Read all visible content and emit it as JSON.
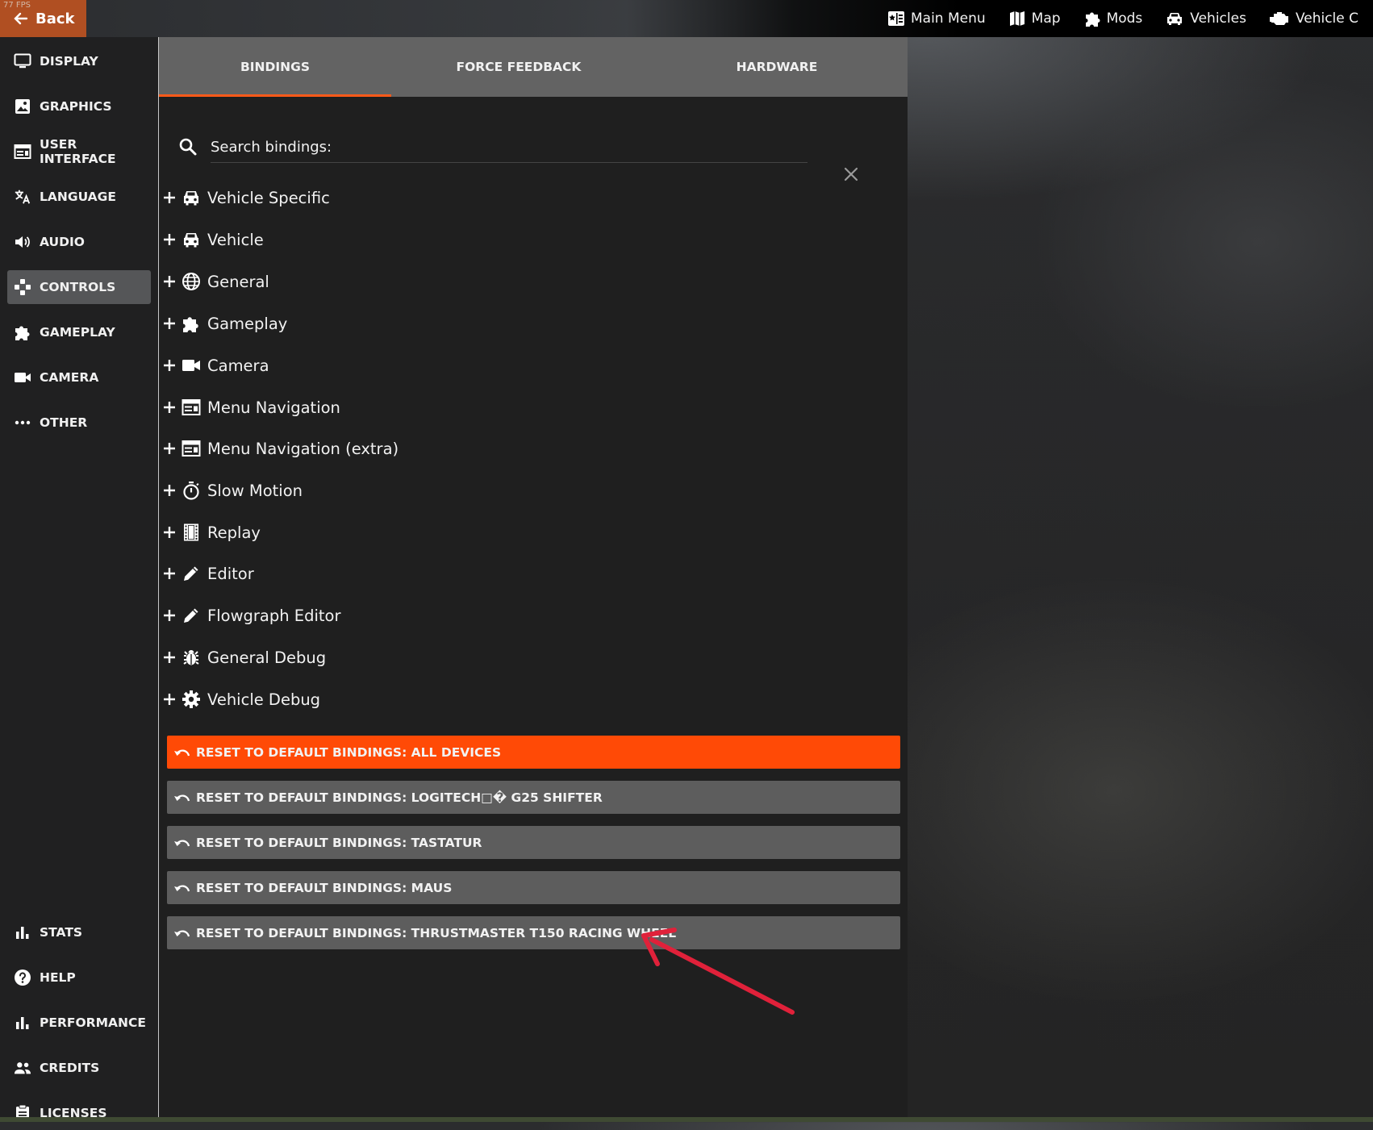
{
  "fps_counter": "77 FPS",
  "topbar": {
    "back_label": "Back",
    "nav": [
      {
        "label": "Main Menu",
        "icon": "main-menu-icon"
      },
      {
        "label": "Map",
        "icon": "map-icon"
      },
      {
        "label": "Mods",
        "icon": "puzzle-icon"
      },
      {
        "label": "Vehicles",
        "icon": "car-icon"
      },
      {
        "label": "Vehicle C",
        "icon": "engine-icon"
      }
    ]
  },
  "sidebar": {
    "items": [
      {
        "label": "DISPLAY",
        "icon": "monitor-icon"
      },
      {
        "label": "GRAPHICS",
        "icon": "image-icon"
      },
      {
        "label": "USER INTERFACE",
        "icon": "window-icon"
      },
      {
        "label": "LANGUAGE",
        "icon": "translate-icon"
      },
      {
        "label": "AUDIO",
        "icon": "speaker-icon"
      },
      {
        "label": "CONTROLS",
        "icon": "gamepad-icon",
        "active": true
      },
      {
        "label": "GAMEPLAY",
        "icon": "puzzle-icon"
      },
      {
        "label": "CAMERA",
        "icon": "camera-icon"
      },
      {
        "label": "OTHER",
        "icon": "more-icon"
      }
    ],
    "bottom_items": [
      {
        "label": "STATS",
        "icon": "bar-chart-icon"
      },
      {
        "label": "HELP",
        "icon": "help-icon"
      },
      {
        "label": "PERFORMANCE",
        "icon": "bar-chart-icon"
      },
      {
        "label": "CREDITS",
        "icon": "people-icon"
      },
      {
        "label": "LICENSES",
        "icon": "clipboard-icon"
      }
    ]
  },
  "tabs": [
    {
      "label": "BINDINGS",
      "active": true
    },
    {
      "label": "FORCE FEEDBACK"
    },
    {
      "label": "HARDWARE"
    }
  ],
  "search": {
    "placeholder": "Search bindings:",
    "value": ""
  },
  "categories": [
    {
      "label": "Vehicle Specific",
      "icon": "car-icon"
    },
    {
      "label": "Vehicle",
      "icon": "car-icon"
    },
    {
      "label": "General",
      "icon": "globe-icon"
    },
    {
      "label": "Gameplay",
      "icon": "puzzle-icon"
    },
    {
      "label": "Camera",
      "icon": "camera-icon"
    },
    {
      "label": "Menu Navigation",
      "icon": "window-icon"
    },
    {
      "label": "Menu Navigation (extra)",
      "icon": "window-icon"
    },
    {
      "label": "Slow Motion",
      "icon": "stopwatch-icon"
    },
    {
      "label": "Replay",
      "icon": "film-icon"
    },
    {
      "label": "Editor",
      "icon": "pencil-icon"
    },
    {
      "label": "Flowgraph Editor",
      "icon": "pencil-icon"
    },
    {
      "label": "General Debug",
      "icon": "bug-icon"
    },
    {
      "label": "Vehicle Debug",
      "icon": "gear-icon"
    }
  ],
  "reset_buttons": [
    {
      "label": "RESET TO DEFAULT BINDINGS: ALL DEVICES",
      "primary": true
    },
    {
      "label": "RESET TO DEFAULT BINDINGS: LOGITECH□� G25 SHIFTER"
    },
    {
      "label": "RESET TO DEFAULT BINDINGS: TASTATUR"
    },
    {
      "label": "RESET TO DEFAULT BINDINGS: MAUS"
    },
    {
      "label": "RESET TO DEFAULT BINDINGS: THRUSTMASTER T150 RACING WHEEL"
    }
  ],
  "colors": {
    "accent": "#ff4a06",
    "back_button": "#b04f22",
    "annotation_arrow": "#e0213a"
  }
}
